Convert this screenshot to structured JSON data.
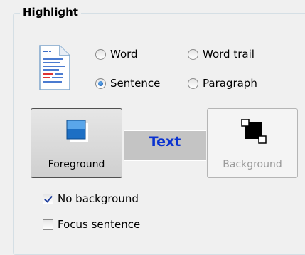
{
  "group": {
    "title": "Highlight"
  },
  "icons": {
    "document": "document-icon",
    "foreground": "foreground-color-icon",
    "background": "background-color-icon"
  },
  "radios": {
    "word": {
      "label": "Word",
      "checked": false
    },
    "word_trail": {
      "label": "Word trail",
      "checked": false
    },
    "sentence": {
      "label": "Sentence",
      "checked": true
    },
    "paragraph": {
      "label": "Paragraph",
      "checked": false
    }
  },
  "buttons": {
    "foreground": {
      "label": "Foreground",
      "state": "pressed"
    },
    "background": {
      "label": "Background",
      "state": "disabled"
    }
  },
  "preview": {
    "text": "Text",
    "text_color": "#0a32d0",
    "bg_color": "#c4c4c4"
  },
  "checkboxes": {
    "no_background": {
      "label": "No background",
      "checked": true
    },
    "focus_sentence": {
      "label": "Focus sentence",
      "checked": false
    }
  }
}
